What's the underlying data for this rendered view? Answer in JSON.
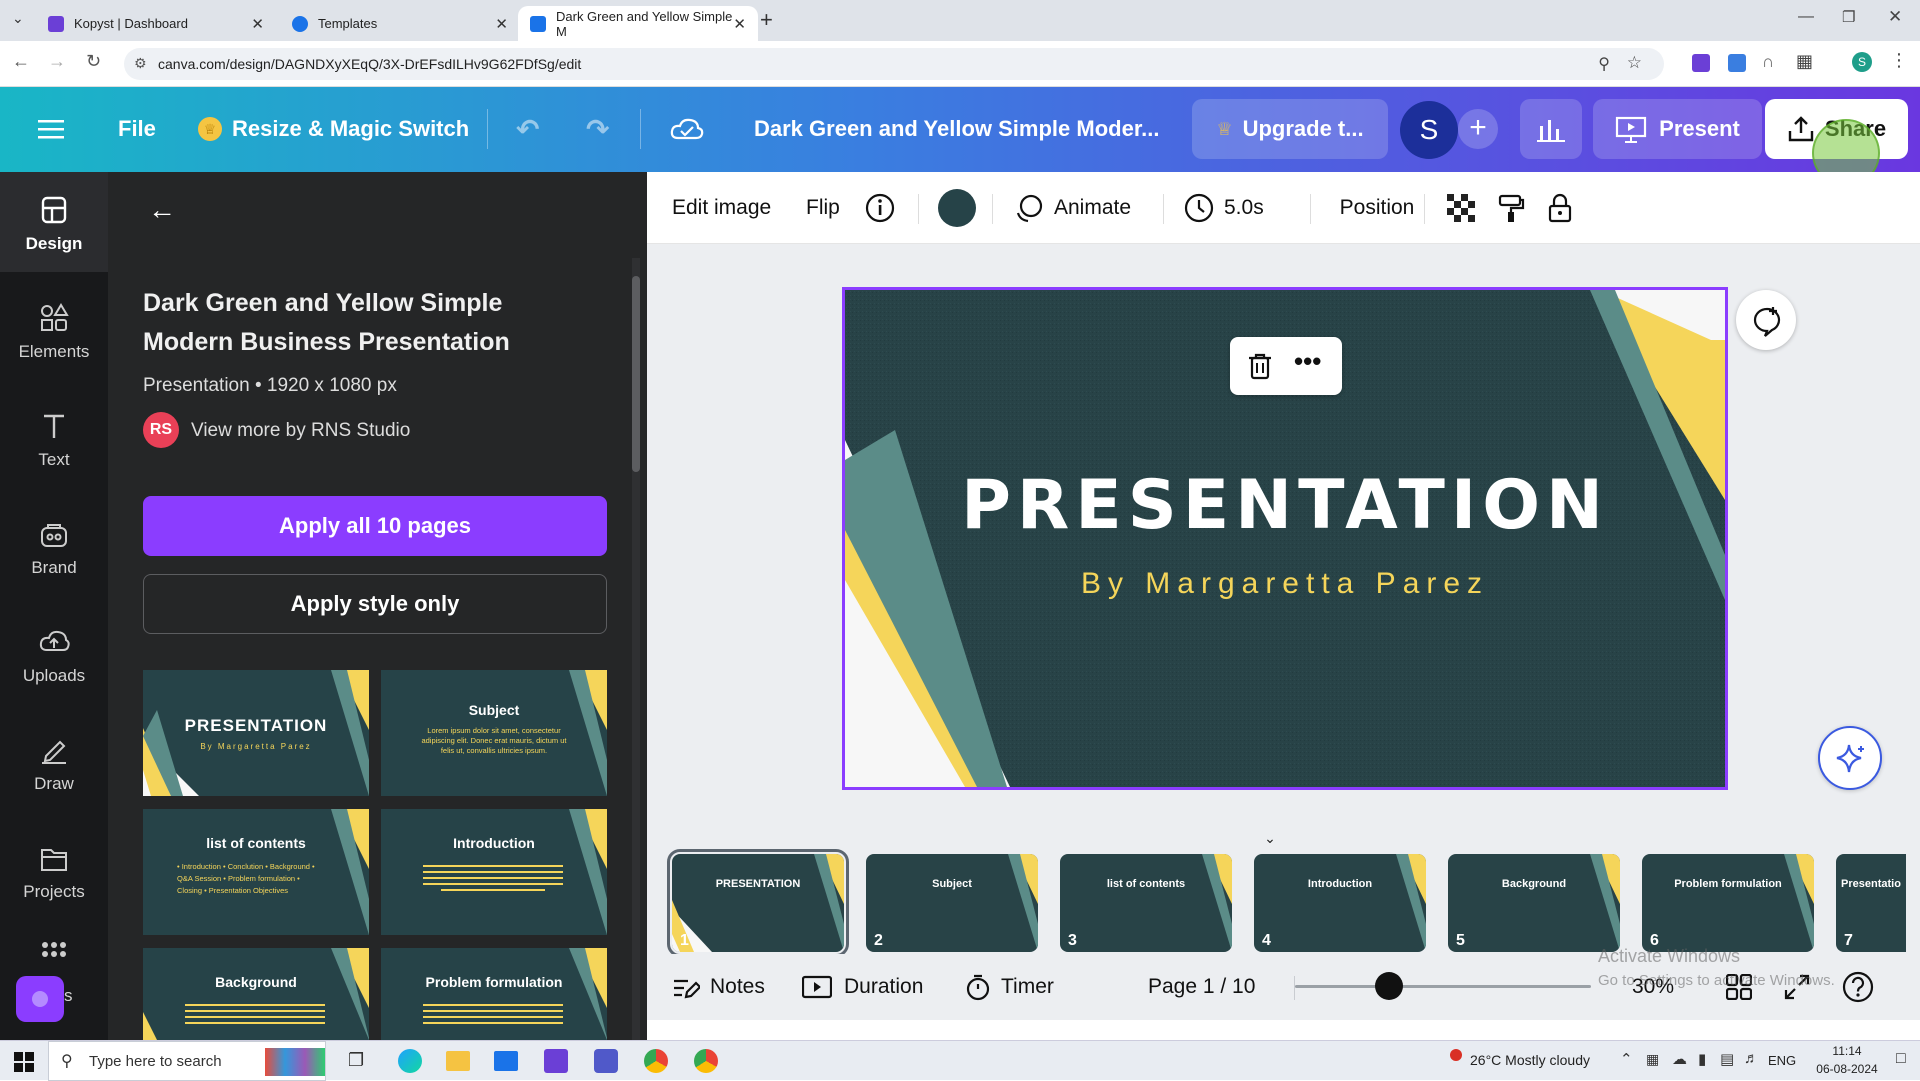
{
  "browser": {
    "tabs": [
      {
        "title": "Kopyst | Dashboard",
        "color": "#6b3fd6"
      },
      {
        "title": "Templates",
        "color": "#1a73e8"
      },
      {
        "title": "Dark Green and Yellow Simple M",
        "color": "#1a73e8"
      }
    ],
    "url": "canva.com/design/DAGNDXyXEqQ/3X-DrEFsdILHv9G62FDfSg/edit"
  },
  "header": {
    "file_label": "File",
    "resize_label": "Resize & Magic Switch",
    "doc_title": "Dark Green and Yellow Simple Moder...",
    "upgrade_label": "Upgrade t...",
    "avatar_letter": "S",
    "present_label": "Present",
    "share_label": "Share"
  },
  "rail": {
    "items": [
      {
        "label": "Design",
        "icon": "design-icon"
      },
      {
        "label": "Elements",
        "icon": "elements-icon"
      },
      {
        "label": "Text",
        "icon": "text-icon"
      },
      {
        "label": "Brand",
        "icon": "brand-icon"
      },
      {
        "label": "Uploads",
        "icon": "uploads-icon"
      },
      {
        "label": "Draw",
        "icon": "draw-icon"
      },
      {
        "label": "Projects",
        "icon": "projects-icon"
      },
      {
        "label": "s",
        "icon": "apps-icon"
      }
    ]
  },
  "panel": {
    "title": "Dark Green and Yellow Simple Modern Business Presentation",
    "meta": "Presentation • 1920 x 1080 px",
    "author_initials": "RS",
    "author_link": "View more by RNS Studio",
    "apply_all": "Apply all 10 pages",
    "apply_style": "Apply style only",
    "thumbnails": [
      {
        "title": "PRESENTATION",
        "sub": "By Margaretta Parez"
      },
      {
        "title": "Subject",
        "sub": "Lorem ipsum dolor sit amet, consectetur adipiscing elit. Donec erat mauris, dictum ut felis ut, convallis ultricies ipsum."
      },
      {
        "title": "list of contents",
        "sub": "• Introduction  • Conclution  • Background  • Q&A Session  • Problem formulation  • Closing  • Presentation Objectives"
      },
      {
        "title": "Introduction",
        "sub": ""
      },
      {
        "title": "Background",
        "sub": ""
      },
      {
        "title": "Problem formulation",
        "sub": ""
      }
    ]
  },
  "toolbar": {
    "edit_image": "Edit image",
    "flip": "Flip",
    "animate": "Animate",
    "duration": "5.0s",
    "position": "Position",
    "swatch_color": "#264348"
  },
  "slide": {
    "title": "PRESENTATION",
    "subtitle": "By Margaretta Parez",
    "bg_color": "#284347",
    "accent_yellow": "#f5d55a",
    "accent_teal": "#5b8c88"
  },
  "pages": [
    {
      "num": "1",
      "title": "PRESENTATION"
    },
    {
      "num": "2",
      "title": "Subject"
    },
    {
      "num": "3",
      "title": "list of contents"
    },
    {
      "num": "4",
      "title": "Introduction"
    },
    {
      "num": "5",
      "title": "Background"
    },
    {
      "num": "6",
      "title": "Problem formulation"
    },
    {
      "num": "7",
      "title": "Presentatio"
    }
  ],
  "bottombar": {
    "notes": "Notes",
    "duration": "Duration",
    "timer": "Timer",
    "page_indicator": "Page 1 / 10",
    "zoom": "30%",
    "zoom_fraction": 0.3
  },
  "watermark": {
    "line1": "Activate Windows",
    "line2": "Go to Settings to activate Windows."
  },
  "taskbar": {
    "search_placeholder": "Type here to search",
    "weather": "26°C  Mostly cloudy",
    "lang": "ENG",
    "time": "11:14",
    "date": "06-08-2024"
  }
}
